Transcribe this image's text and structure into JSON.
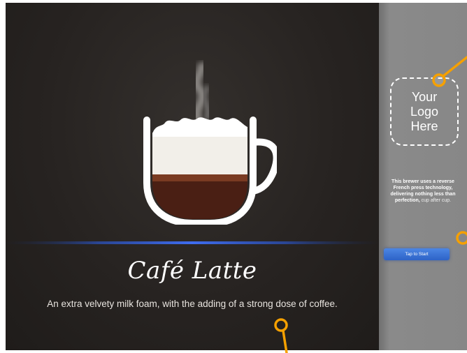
{
  "product": {
    "title": "Café Latte",
    "description": "An extra velvety milk foam, with the adding of a strong dose of coffee."
  },
  "sidebar": {
    "logo_lines": [
      "Your",
      "Logo",
      "Here"
    ],
    "info_bold": "This brewer uses a reverse French press technology, delivering nothing less than perfection,",
    "info_light": "cup after cup.",
    "start_button_label": "Tap to Start"
  },
  "colors": {
    "screen_bg": "#272321",
    "sidebar_bg": "#878787",
    "accent_blue": "#2d63c7",
    "annotation_orange": "#f5a000"
  },
  "icons": {
    "cup": "latte-cup-icon",
    "steam": "steam-icon"
  }
}
